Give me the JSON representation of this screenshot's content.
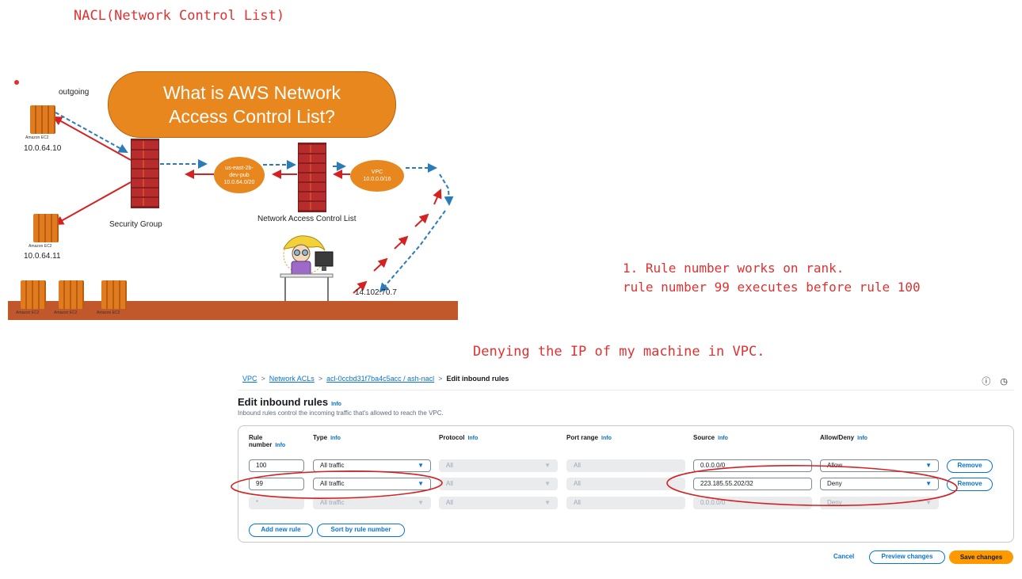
{
  "notes": {
    "title": "NACL(Network Control List)",
    "rank_line1": "1. Rule number works on rank.",
    "rank_line2": "rule number 99 executes before rule 100",
    "deny_note": "Denying the IP of my machine in VPC."
  },
  "diagram": {
    "bubble_line1": "What is AWS Network",
    "bubble_line2": "Access Control List?",
    "outgoing": "outgoing",
    "ip_top": "10.0.64.10",
    "ip_mid": "10.0.64.11",
    "ip_user": "14.102.70.7",
    "security_group": "Security Group",
    "nacl": "Network Access Control List",
    "subnet_line1": "us-east-2b-",
    "subnet_line2": "dev-pub",
    "subnet_line3": "10.0.64.0/20",
    "vpc_line1": "VPC",
    "vpc_line2": "10.0.0.0/16",
    "ec2_tag": "Amazon EC2",
    "icon_names": [
      "ec2-icon",
      "firewall-icon",
      "user-icon"
    ]
  },
  "breadcrumb": {
    "vpc": "VPC",
    "acls": "Network ACLs",
    "acl": "acl-0ccbd31f7ba4c5acc / ash-nacl",
    "current": "Edit inbound rules"
  },
  "header": {
    "title": "Edit inbound rules",
    "info": "Info",
    "subtitle": "Inbound rules control the incoming traffic that's allowed to reach the VPC."
  },
  "columns": {
    "rule_line1": "Rule",
    "rule_line2": "number",
    "type": "Type",
    "protocol": "Protocol",
    "port_range": "Port range",
    "source": "Source",
    "allow_deny": "Allow/Deny",
    "info": "Info"
  },
  "rows": [
    {
      "number": "100",
      "type": "All traffic",
      "protocol": "All",
      "port": "All",
      "source": "0.0.0.0/0",
      "action": "Allow",
      "remove": "Remove"
    },
    {
      "number": "99",
      "type": "All traffic",
      "protocol": "All",
      "port": "All",
      "source": "223.185.55.202/32",
      "action": "Deny",
      "remove": "Remove"
    },
    {
      "number": "*",
      "type": "All traffic",
      "protocol": "All",
      "port": "All",
      "source": "0.0.0.0/0",
      "action": "Deny"
    }
  ],
  "actions": {
    "add_rule": "Add new rule",
    "sort": "Sort by rule number",
    "cancel": "Cancel",
    "preview": "Preview changes",
    "save": "Save changes"
  },
  "colors": {
    "accent": "#0972d3",
    "save": "#ff9900",
    "annotation": "#e03131",
    "diagram_orange": "#e8871e"
  }
}
